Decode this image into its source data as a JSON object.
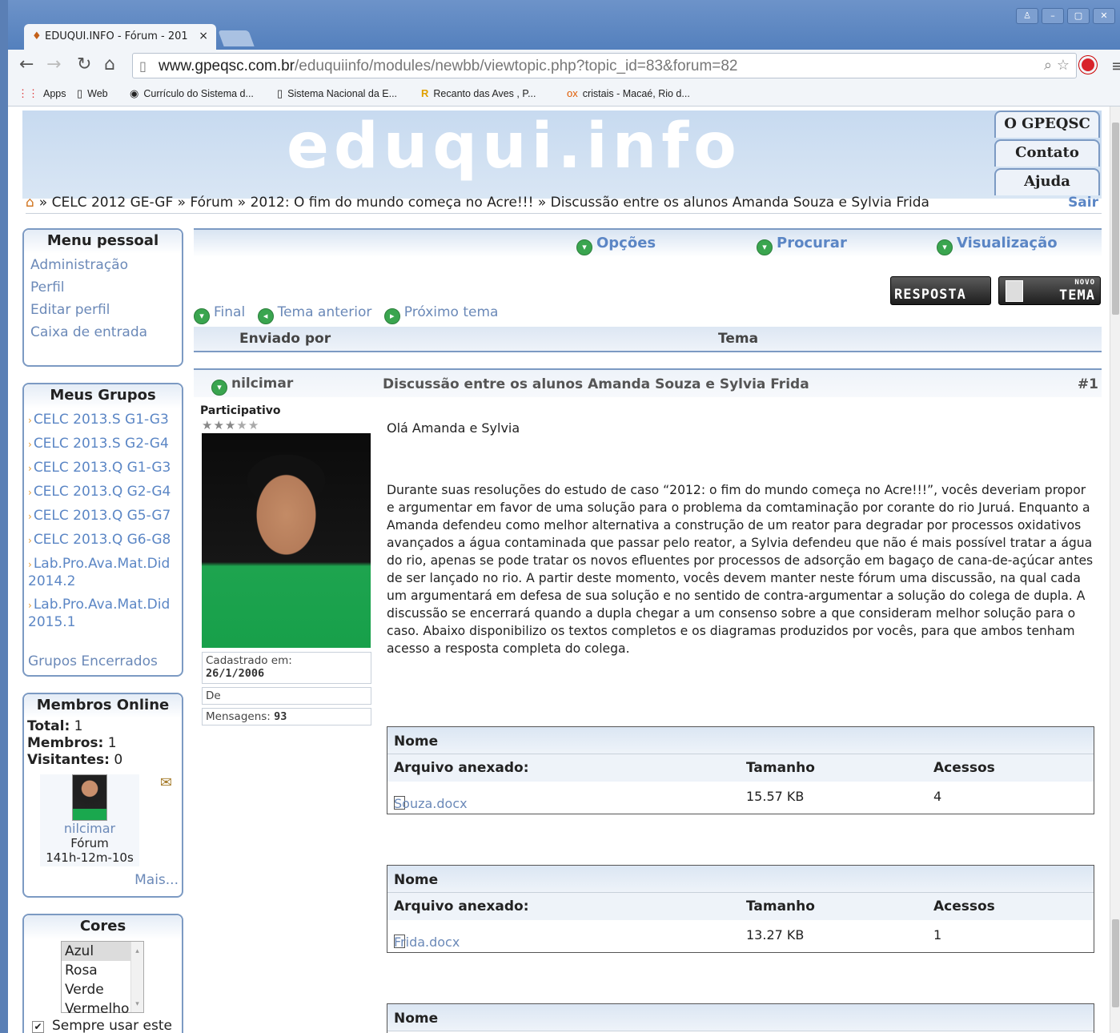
{
  "browser": {
    "tab_title": "EDUQUI.INFO - Fórum - 201",
    "url_domain": "www.gpeqsc.com.br",
    "url_path": "/eduquiinfo/modules/newbb/viewtopic.php?topic_id=83&forum=82",
    "bookmarks": [
      "Apps",
      "Web",
      "Currículo do Sistema d...",
      "Sistema Nacional da E...",
      "Recanto das Aves , P...",
      "cristais - Macaé, Rio d..."
    ]
  },
  "header": {
    "logo": "eduqui.info",
    "nav": [
      "O GPEQSC",
      "Contato",
      "Ajuda"
    ],
    "breadcrumb": "» CELC 2012 GE-GF » Fórum » 2012: O fim do mundo começa no Acre!!! » Discussão entre os alunos Amanda Souza e Sylvia Frida",
    "logout": "Sair"
  },
  "sidebar": {
    "menu_title": "Menu pessoal",
    "menu_items": [
      "Administração",
      "Perfil",
      "Editar perfil",
      "Caixa de entrada"
    ],
    "groups_title": "Meus Grupos",
    "groups": [
      "CELC 2013.S G1-G3",
      "CELC 2013.S G2-G4",
      "CELC 2013.Q G1-G3",
      "CELC 2013.Q G2-G4",
      "CELC 2013.Q G5-G7",
      "CELC 2013.Q G6-G8",
      "Lab.Pro.Ava.Mat.Did 2014.2",
      "Lab.Pro.Ava.Mat.Did 2015.1"
    ],
    "closed_groups": "Grupos Encerrados",
    "online_title": "Membros Online",
    "total_label": "Total:",
    "total": "1",
    "members_label": "Membros:",
    "members": "1",
    "visitors_label": "Visitantes:",
    "visitors": "0",
    "online_user": "nilcimar",
    "online_location": "Fórum",
    "online_time": "141h-12m-10s",
    "more": "Mais...",
    "colors_title": "Cores",
    "colors": [
      "Azul",
      "Rosa",
      "Verde",
      "Vermelho"
    ],
    "always_use": "Sempre usar este"
  },
  "main": {
    "options": [
      "Opções",
      "Procurar",
      "Visualização"
    ],
    "reply_button": "RESPOSTA",
    "new_topic_small": "NOVO",
    "new_topic_button": "TEMA",
    "nav_links": [
      "Final",
      "Tema anterior",
      "Próximo tema"
    ],
    "col_author": "Enviado por",
    "col_topic": "Tema",
    "post": {
      "author": "nilcimar",
      "subject": "Discussão entre os alunos Amanda Souza e Sylvia Frida",
      "number": "#1",
      "rank": "Participativo",
      "rating": 3,
      "registered_label": "Cadastrado em:",
      "registered": "26/1/2006",
      "from_label": "De",
      "posts_label": "Mensagens:",
      "posts": "93",
      "greeting": "Olá Amanda e Sylvia",
      "body": "Durante suas resoluções do estudo de caso “2012: o fim do mundo começa no Acre!!!”, vocês deveriam propor e argumentar em favor de uma solução para o problema da comtaminação por corante do rio Juruá. Enquanto a Amanda defendeu como melhor alternativa a construção de um reator para degradar por processos oxidativos avançados a água contaminada que passar pelo reator, a Sylvia defendeu que não é mais possível tratar a água do rio, apenas se pode tratar os novos efluentes por processos de adsorção em bagaço de cana-de-açúcar antes de ser lançado no rio.  A partir deste momento, vocês devem manter neste fórum uma discussão, na qual cada um argumentará em defesa de sua solução e no sentido de contra-argumentar a solução do colega de dupla. A discussão se encerrará quando a dupla chegar a um consenso sobre a que consideram melhor solução para o caso. Abaixo disponibilizo os textos completos e os diagramas produzidos por vocês, para que ambos tenham acesso a resposta completa do colega."
    },
    "attachments": {
      "name_header": "Nome",
      "file_header": "Arquivo anexado:",
      "size_header": "Tamanho",
      "access_header": "Acessos",
      "files": [
        {
          "name": "Souza.docx",
          "size": "15.57 KB",
          "accesses": "4"
        },
        {
          "name": "Frida.docx",
          "size": "13.27 KB",
          "accesses": "1"
        }
      ]
    }
  }
}
